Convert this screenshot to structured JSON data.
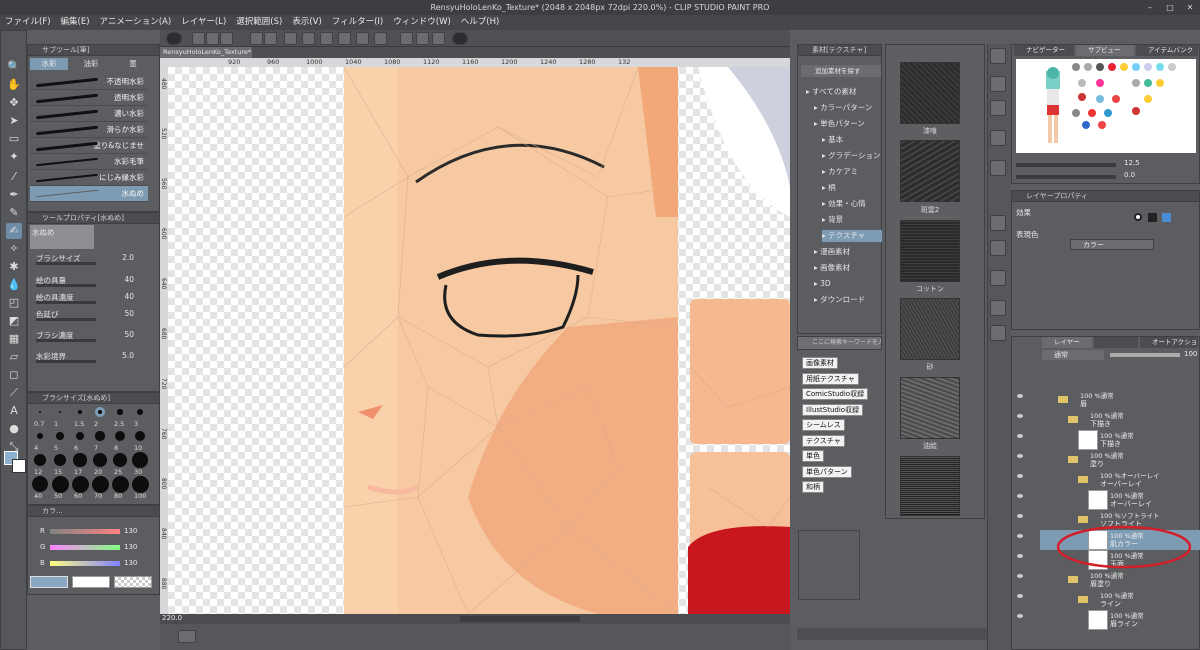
{
  "window": {
    "title": "RensyuHoloLenKo_Texture* (2048 x 2048px 72dpi 220.0%)  - CLIP STUDIO PAINT PRO"
  },
  "menu": [
    "ファイル(F)",
    "編集(E)",
    "アニメーション(A)",
    "レイヤー(L)",
    "選択範囲(S)",
    "表示(V)",
    "フィルター(I)",
    "ウィンドウ(W)",
    "ヘルプ(H)"
  ],
  "subtool_panel": {
    "title": "サブツール[筆]",
    "tabs": [
      "水彩",
      "油彩",
      "墨"
    ],
    "brushes": [
      "不透明水彩",
      "透明水彩",
      "濃い水彩",
      "滑らか水彩",
      "塗り&なじませ",
      "水彩毛筆",
      "にじみ縁水彩",
      "水ぬめ"
    ],
    "selected_index": 7
  },
  "tool_property": {
    "title": "ツールプロパティ[水ぬめ]",
    "brush_name": "水ぬめ",
    "rows": [
      {
        "label": "ブラシサイズ",
        "value": "2.0"
      },
      {
        "label": "絵の具量",
        "value": "40"
      },
      {
        "label": "絵の具濃度",
        "value": "40"
      },
      {
        "label": "色延び",
        "value": "50"
      },
      {
        "label": "ブラシ濃度",
        "value": "50"
      },
      {
        "label": "水彩境界",
        "value": "5.0"
      }
    ]
  },
  "brush_size_panel": {
    "title": "ブラシサイズ[水ぬめ]",
    "sizes": [
      "0.7",
      "1",
      "1.5",
      "2",
      "2.5",
      "3",
      "4",
      "5",
      "6",
      "7",
      "8",
      "10",
      "12",
      "15",
      "17",
      "20",
      "25",
      "30",
      "40",
      "50",
      "60",
      "70",
      "80",
      "100"
    ]
  },
  "color_panel": {
    "title": "カラ...",
    "channels": [
      {
        "label": "R",
        "value": "130"
      },
      {
        "label": "G",
        "value": "130"
      },
      {
        "label": "B",
        "value": "130"
      }
    ]
  },
  "canvas": {
    "tab": "RensyuHoloLenKo_Texture*",
    "ruler": [
      "920",
      "960",
      "1000",
      "1040",
      "1080",
      "1120",
      "1160",
      "1200",
      "1240",
      "1280",
      "132"
    ],
    "vruler": [
      "480",
      "520",
      "560",
      "600",
      "640",
      "680",
      "720",
      "760",
      "800",
      "840",
      "880"
    ],
    "zoom": "220.0"
  },
  "material_panel": {
    "title": "素材[テクスチャ]",
    "add_label": "追加素材を探す",
    "tree": [
      {
        "label": "すべての素材",
        "indent": 0
      },
      {
        "label": "カラーパターン",
        "indent": 1
      },
      {
        "label": "単色パターン",
        "indent": 1
      },
      {
        "label": "基本",
        "indent": 2
      },
      {
        "label": "グラデーション",
        "indent": 2
      },
      {
        "label": "カケアミ",
        "indent": 2
      },
      {
        "label": "柄",
        "indent": 2
      },
      {
        "label": "効果・心情",
        "indent": 2
      },
      {
        "label": "背景",
        "indent": 2
      },
      {
        "label": "テクスチャ",
        "indent": 2,
        "selected": true
      },
      {
        "label": "漫画素材",
        "indent": 1
      },
      {
        "label": "画像素材",
        "indent": 1
      },
      {
        "label": "3D",
        "indent": 1
      },
      {
        "label": "ダウンロード",
        "indent": 1
      }
    ],
    "search_placeholder": "ここに検索キーワードを入力",
    "tags": [
      "画像素材",
      "用紙テクスチャ",
      "ComicStudio収録",
      "IllustStudio収録",
      "シームレス",
      "テクスチャ",
      "単色",
      "単色パターン",
      "和柄"
    ],
    "thumbnails": [
      "漆喰",
      "斑雲2",
      "コットン",
      "砂",
      "油絵",
      ""
    ]
  },
  "navigator": {
    "tabs": [
      "ナビゲーター",
      "サブビュー",
      "アイテムバンク"
    ],
    "zoom": "12.5",
    "angle": "0.0"
  },
  "layer_property": {
    "title": "レイヤープロパティ",
    "effect_label": "効果",
    "expr_label": "表現色",
    "expr_value": "カラー"
  },
  "layer_panel": {
    "tabs": [
      "レイヤー",
      "",
      "オートアクション"
    ],
    "blend": "通常",
    "opacity": "100",
    "layers": [
      {
        "mode": "100 %通常",
        "name": "眉",
        "type": "folder",
        "indent": 1
      },
      {
        "mode": "100 %通常",
        "name": "下描き",
        "type": "folder",
        "indent": 2
      },
      {
        "mode": "100 %通常",
        "name": "下描き",
        "type": "layer",
        "indent": 3
      },
      {
        "mode": "100 %通常",
        "name": "塗り",
        "type": "folder",
        "indent": 2
      },
      {
        "mode": "100 %オーバーレイ",
        "name": "オーバーレイ",
        "type": "folder",
        "indent": 3
      },
      {
        "mode": "100 %通常",
        "name": "オーバーレイ",
        "type": "layer",
        "indent": 4
      },
      {
        "mode": "100 %ソフトライト",
        "name": "ソフトライト",
        "type": "folder",
        "indent": 3
      },
      {
        "mode": "100 %通常",
        "name": "肌カラー",
        "type": "layer",
        "indent": 4,
        "selected": true
      },
      {
        "mode": "100 %通常",
        "name": "玉面",
        "type": "layer",
        "indent": 4
      },
      {
        "mode": "100 %通常",
        "name": "眉塗り",
        "type": "folder",
        "indent": 2
      },
      {
        "mode": "100 %通常",
        "name": "ライン",
        "type": "folder",
        "indent": 3
      },
      {
        "mode": "100 %通常",
        "name": "眉ライン",
        "type": "layer",
        "indent": 4
      }
    ]
  },
  "colors": {
    "highlight": "#9bb7cf",
    "skin": "#f7c9a2",
    "skin_dark": "#f2a879",
    "annotation": "#d21f2a",
    "cloth": "#c8161e"
  }
}
